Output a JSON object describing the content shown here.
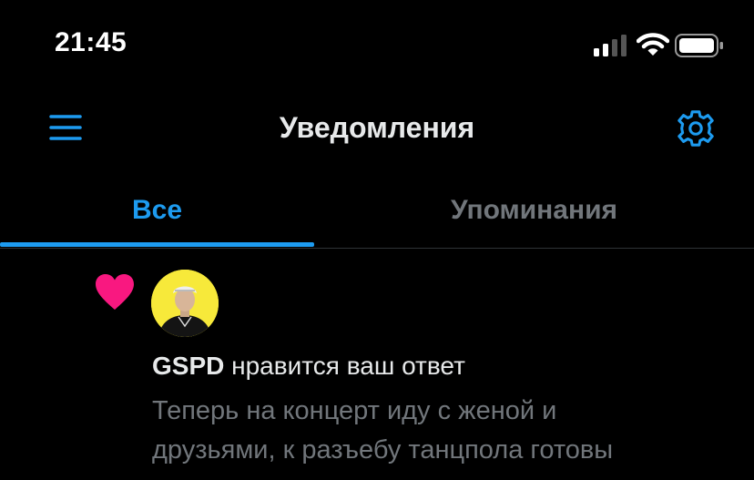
{
  "status_bar": {
    "time": "21:45"
  },
  "header": {
    "title": "Уведомления"
  },
  "tabs": [
    {
      "label": "Все",
      "active": true
    },
    {
      "label": "Упоминания",
      "active": false
    }
  ],
  "notifications": [
    {
      "type": "like",
      "icon": "heart-icon",
      "user": "GSPD",
      "action": " нравится ваш ответ",
      "preview_lines": [
        "Теперь на концерт иду с женой и",
        "друзьями, к разъебу танцпола готовы"
      ]
    }
  ],
  "colors": {
    "background": "#000000",
    "accent": "#1d9bf0",
    "primary_text": "#e7e9ea",
    "secondary_text": "#71767b",
    "like": "#f91880",
    "avatar_bg": "#f7e93a"
  }
}
